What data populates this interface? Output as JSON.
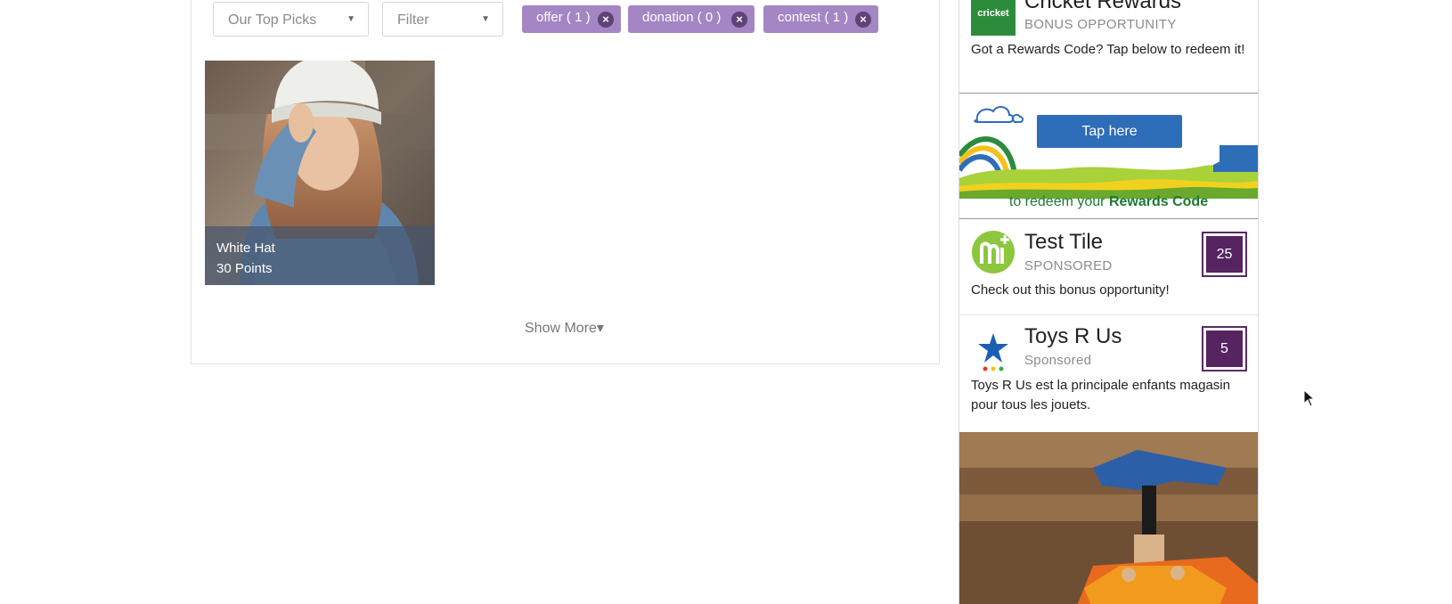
{
  "filters": {
    "sort_value": "Our Top Picks",
    "filter_value": "Filter",
    "chips": [
      {
        "label": "offer ( 1 )"
      },
      {
        "label": "donation ( 0 )"
      },
      {
        "label": "contest ( 1 )"
      }
    ],
    "remove_glyph": "×",
    "caret_glyph": "▼"
  },
  "rewards": [
    {
      "name": "White Hat",
      "points": "30 Points"
    }
  ],
  "show_more": "Show More▾",
  "sidebar": {
    "cricket": {
      "logo_text": "cricket",
      "title": "Cricket Rewards",
      "subtitle": "BONUS OPPORTUNITY",
      "description": "Got a Rewards Code? Tap below to redeem it!",
      "banner_button": "Tap here",
      "banner_text_prefix": "to redeem your ",
      "banner_text_bold": "Rewards Code"
    },
    "test_tile": {
      "title": "Test Tile",
      "subtitle": "SPONSORED",
      "description": "Check out this bonus opportunity!",
      "points": "25"
    },
    "toys": {
      "title": "Toys R Us",
      "subtitle": "Sponsored",
      "description": "Toys R Us est la principale enfants magasin pour tous les jouets.",
      "points": "5"
    }
  },
  "colors": {
    "chip": "#a486c4",
    "points_badge": "#562460",
    "cricket_green": "#2c8c3c",
    "tap_button": "#2e6db8"
  }
}
